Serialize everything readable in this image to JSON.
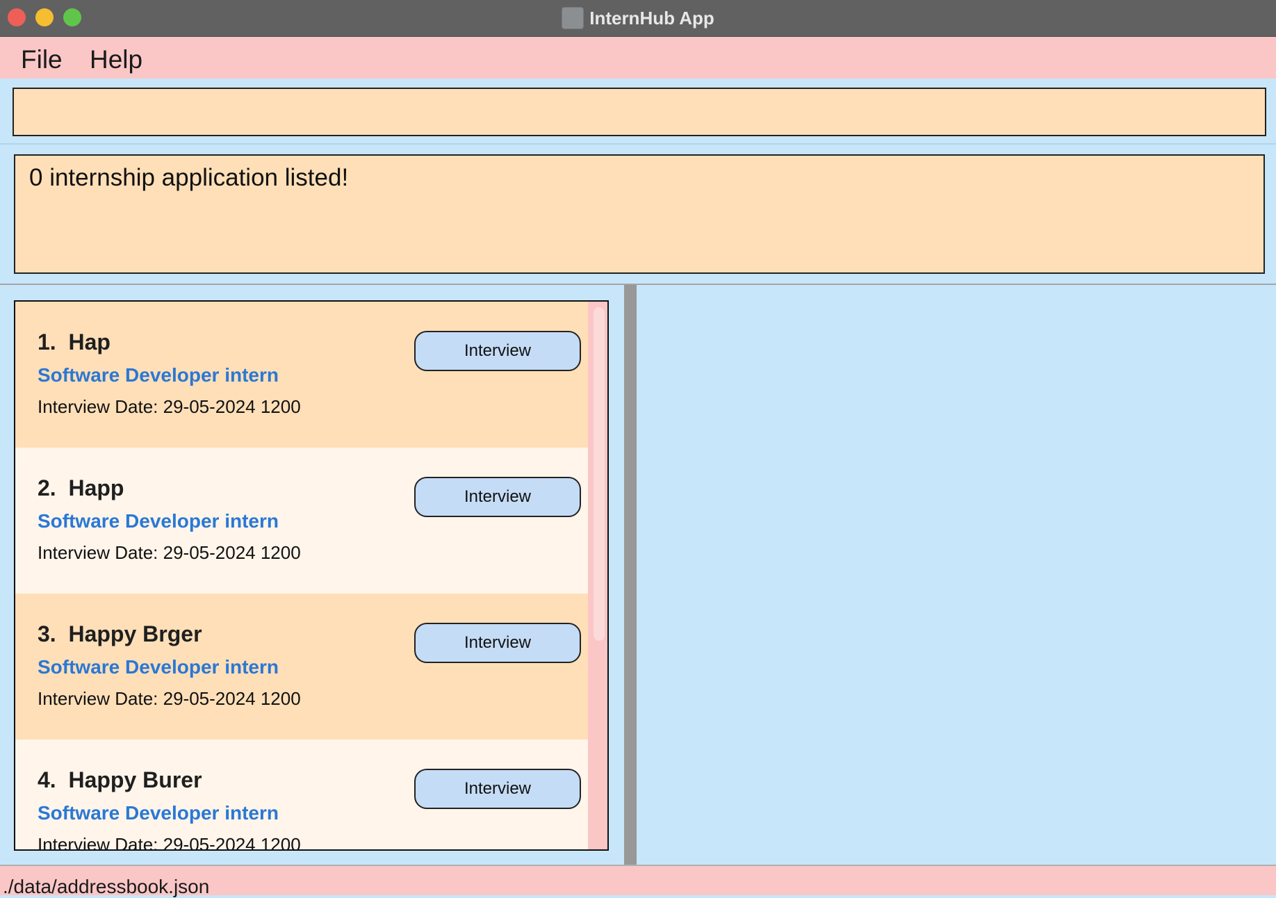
{
  "window": {
    "title": "InternHub App"
  },
  "menu": {
    "file": "File",
    "help": "Help"
  },
  "command_box": {
    "value": ""
  },
  "result": {
    "message": "0 internship application listed!"
  },
  "applications": [
    {
      "index": "1.",
      "company": "Hap",
      "role": "Software Developer intern",
      "date": "Interview Date: 29-05-2024 1200",
      "status": "Interview"
    },
    {
      "index": "2.",
      "company": "Happ",
      "role": "Software Developer intern",
      "date": "Interview Date: 29-05-2024 1200",
      "status": "Interview"
    },
    {
      "index": "3.",
      "company": "Happy Brger",
      "role": "Software Developer intern",
      "date": "Interview Date: 29-05-2024 1200",
      "status": "Interview"
    },
    {
      "index": "4.",
      "company": "Happy Burer",
      "role": "Software Developer intern",
      "date": "Interview Date: 29-05-2024 1200",
      "status": "Interview"
    }
  ],
  "statusbar": {
    "path": "./data/addressbook.json"
  },
  "colors": {
    "menubar": "#fac6c6",
    "panel_background": "#c8e6fa",
    "card_odd": "#ffdfb8",
    "card_even": "#fff5eb",
    "role_text": "#2a78d4",
    "status_button": "#c4dcf6"
  }
}
